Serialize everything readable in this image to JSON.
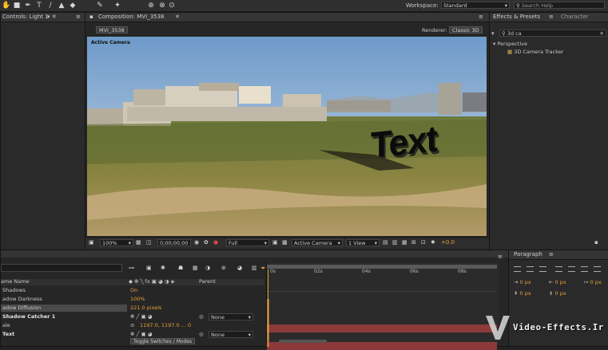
{
  "workspace": {
    "label": "Workspace:",
    "value": "Standard"
  },
  "search_help": {
    "placeholder": "Search Help"
  },
  "effect_controls": {
    "tab": "Controls: Light 1"
  },
  "composition": {
    "tab": "Composition: MVI_3538",
    "subtab": "MVI_3538",
    "renderer_label": "Renderer:",
    "renderer_value": "Classic 3D",
    "active_camera_label": "Active Camera",
    "text_overlay": "Text"
  },
  "viewer_bar": {
    "zoom": "100%",
    "timecode": "0;00;00;00",
    "resolution": "Full",
    "view": "Active Camera",
    "views": "1 View",
    "exposure": "+0.0"
  },
  "effects_presets": {
    "tab": "Effects & Presets",
    "tab2": "Character",
    "search_value": "3d ca",
    "category": "Perspective",
    "item": "3D Camera Tracker"
  },
  "paragraph": {
    "tab": "Paragraph",
    "values": [
      "0 px",
      "0 px",
      "0 px",
      "0 px",
      "0 px"
    ]
  },
  "timeline": {
    "column_header": "ame Name",
    "parent_header": "Parent",
    "rows": [
      {
        "name": "Shadows",
        "value": "On",
        "bold": false
      },
      {
        "name": "adow Darkness",
        "value": "100%",
        "bold": false
      },
      {
        "name": "adow Diffusion",
        "value": "221.0 pixels",
        "bold": false
      },
      {
        "name": "Shadow Catcher 1",
        "value": "",
        "parent": "None",
        "bold": true
      },
      {
        "name": "ale",
        "value": "1197.0, 1197.0 ... 0",
        "bold": false
      },
      {
        "name": "Text",
        "value": "",
        "parent": "None",
        "bold": true
      }
    ],
    "ruler_labels": [
      "0s",
      "02s",
      "04s",
      "06s",
      "08s"
    ],
    "toggle_label": "Toggle Switches / Modes"
  },
  "watermark": "Video-Effects.Ir"
}
